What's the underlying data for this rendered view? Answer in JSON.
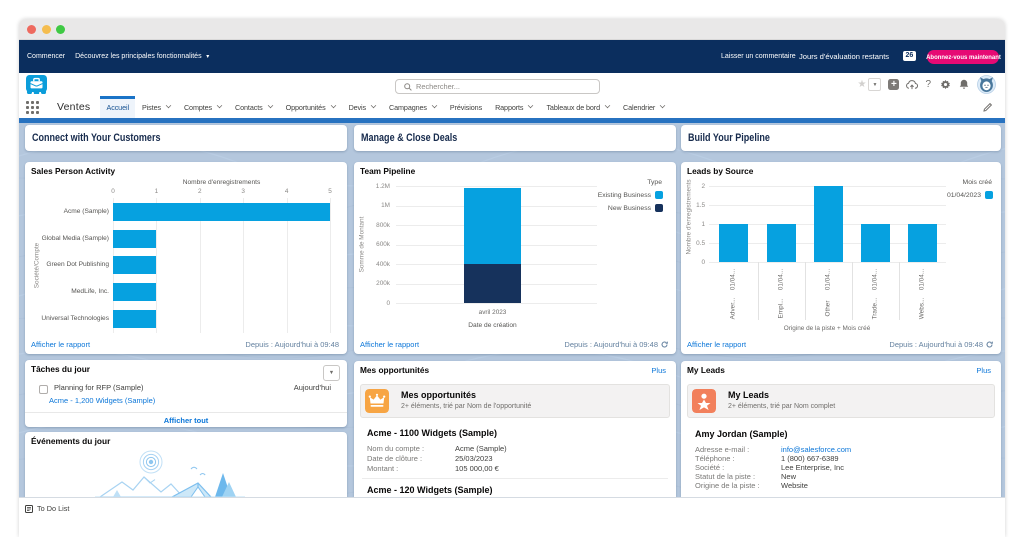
{
  "browser": {
    "traffic_lights": [
      "close",
      "minimize",
      "zoom"
    ]
  },
  "trial_bar": {
    "get_started": "Commencer",
    "discover": "Découvrez les principales fonctionnalités",
    "feedback": "Laisser un commentaire",
    "days_label": "Jours d'évaluation restants",
    "days_value": "26",
    "subscribe": "Abonnez-vous maintenant"
  },
  "header": {
    "search_placeholder": "Rechercher...",
    "icons": [
      "favorites-star",
      "favorites-dropdown",
      "global-actions-plus",
      "trailhead-cloud",
      "help-question",
      "setup-gear",
      "notifications-bell",
      "user-avatar"
    ]
  },
  "nav": {
    "app_name": "Ventes",
    "tabs": [
      {
        "label": "Accueil",
        "active": true,
        "chevron": false
      },
      {
        "label": "Pistes",
        "active": false,
        "chevron": true
      },
      {
        "label": "Comptes",
        "active": false,
        "chevron": true
      },
      {
        "label": "Contacts",
        "active": false,
        "chevron": true
      },
      {
        "label": "Opportunités",
        "active": false,
        "chevron": true
      },
      {
        "label": "Devis",
        "active": false,
        "chevron": true
      },
      {
        "label": "Campagnes",
        "active": false,
        "chevron": true
      },
      {
        "label": "Prévisions",
        "active": false,
        "chevron": false
      },
      {
        "label": "Rapports",
        "active": false,
        "chevron": true
      },
      {
        "label": "Tableaux de bord",
        "active": false,
        "chevron": true
      },
      {
        "label": "Calendrier",
        "active": false,
        "chevron": true
      }
    ]
  },
  "sections": {
    "left_title": "Connect with Your Customers",
    "middle_title": "Manage & Close Deals",
    "right_title": "Build Your Pipeline"
  },
  "footer_links": {
    "view_report": "Afficher le rapport",
    "as_of": "Depuis : Aujourd'hui à 09:48"
  },
  "chart_data": [
    {
      "type": "bar",
      "orientation": "horizontal",
      "title": "Sales Person Activity",
      "categories": [
        "Acme (Sample)",
        "Global Media (Sample)",
        "Green Dot Publishing",
        "MedLife, Inc.",
        "Universal Technologies"
      ],
      "values": [
        5,
        1,
        1,
        1,
        1
      ],
      "xlabel": "Nombre d'enregistrements",
      "ylabel": "Société/Compte",
      "xlim": [
        0,
        5
      ],
      "xticks": [
        0,
        1,
        2,
        3,
        4,
        5
      ],
      "bar_color": "#06a1e0",
      "grid": true,
      "legend_position": "none"
    },
    {
      "type": "bar",
      "orientation": "vertical",
      "stacked": true,
      "title": "Team Pipeline",
      "categories": [
        "avril 2023"
      ],
      "series": [
        {
          "name": "New Business",
          "values": [
            405000
          ],
          "color": "#16325c"
        },
        {
          "name": "Existing Business",
          "values": [
            770000
          ],
          "color": "#06a1e0"
        }
      ],
      "legend_title": "Type",
      "legend_order": [
        "Existing Business",
        "New Business"
      ],
      "legend_position": "right",
      "xlabel": "Date de création",
      "ylabel": "Somme de Montant",
      "ylim": [
        0,
        1200000
      ],
      "ytick_labels": [
        "1.2M",
        "1M",
        "800k",
        "600k",
        "400k",
        "200k",
        "0"
      ],
      "grid": true
    },
    {
      "type": "bar",
      "orientation": "vertical",
      "title": "Leads by Source",
      "categories": [
        "Adver...",
        "Empl...",
        "Other",
        "Trade...",
        "Webs..."
      ],
      "category_suffix": "01/04...",
      "values": [
        1,
        1,
        2,
        1,
        1
      ],
      "xlabel": "Origine de la piste + Mois créé",
      "ylabel": "Nombre d'enregistrements",
      "ylim": [
        0,
        2
      ],
      "ytick_labels": [
        "2",
        "1.5",
        "1",
        "0.5",
        "0"
      ],
      "legend_title": "Mois créé",
      "legend_items": [
        {
          "label": "01/04/2023",
          "color": "#06a1e0"
        }
      ],
      "bar_color": "#06a1e0",
      "grid": true
    }
  ],
  "tasks_card": {
    "title": "Tâches du jour",
    "item": {
      "label": "Planning for RFP (Sample)",
      "due": "Aujourd'hui",
      "link": "Acme - 1,200 Widgets (Sample)"
    },
    "view_all": "Afficher tout"
  },
  "events_card": {
    "title": "Événements du jour"
  },
  "opportunities_card": {
    "title": "Mes opportunités",
    "more": "Plus",
    "banner_title": "Mes opportunités",
    "banner_subtitle": "2+ éléments, trié par Nom de l'opportunité",
    "icon_color": "#f7a544",
    "records": [
      {
        "name": "Acme - 1100 Widgets (Sample)",
        "fields": [
          {
            "label": "Nom du compte :",
            "value": "Acme (Sample)"
          },
          {
            "label": "Date de clôture :",
            "value": "25/03/2023"
          },
          {
            "label": "Montant :",
            "value": "105 000,00 €"
          }
        ]
      },
      {
        "name": "Acme - 120 Widgets (Sample)",
        "fields": []
      }
    ]
  },
  "leads_card": {
    "title": "My Leads",
    "more": "Plus",
    "banner_title": "My Leads",
    "banner_subtitle": "2+ éléments, trié par Nom complet",
    "icon_color": "#f2805c",
    "records": [
      {
        "name": "Amy Jordan (Sample)",
        "fields": [
          {
            "label": "Adresse e-mail :",
            "value": "info@salesforce.com",
            "link": true
          },
          {
            "label": "Téléphone :",
            "value": "1 (800) 667-6389"
          },
          {
            "label": "Société :",
            "value": "Lee Enterprise, Inc"
          },
          {
            "label": "Statut de la piste :",
            "value": "New"
          },
          {
            "label": "Origine de la piste :",
            "value": "Website"
          }
        ]
      }
    ]
  },
  "utility_bar": {
    "todo": "To Do List"
  },
  "colors": {
    "topbar_navy": "#0b2e5e",
    "subscribe_pink": "#e60a74",
    "content_bg": "#b4c7dd",
    "chart_blue": "#06a1e0",
    "chart_navy": "#16325c",
    "link_blue": "#0b76d8",
    "nav_strip_blue": "#2772c0"
  }
}
